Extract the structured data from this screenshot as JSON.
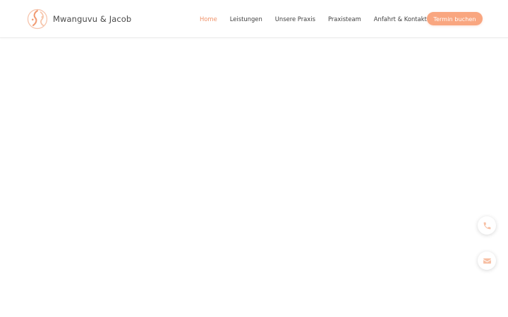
{
  "brand": {
    "name": "Mwanguvu & Jacob",
    "logo_icon": "logo-profile-icon"
  },
  "nav": {
    "items": [
      {
        "label": "Home",
        "active": true
      },
      {
        "label": "Leistungen",
        "active": false
      },
      {
        "label": "Unsere Praxis",
        "active": false
      },
      {
        "label": "Praxisteam",
        "active": false
      },
      {
        "label": "Anfahrt & Kontakt",
        "active": false
      }
    ],
    "cta_label": "Termin buchen"
  },
  "floating": {
    "phone_icon": "phone-icon",
    "mail_icon": "envelope-icon"
  },
  "colors": {
    "accent": "#f0936a",
    "cta_background": "#f9a680",
    "text": "#3f3f3f",
    "icon_light": "#f7bfa3"
  }
}
